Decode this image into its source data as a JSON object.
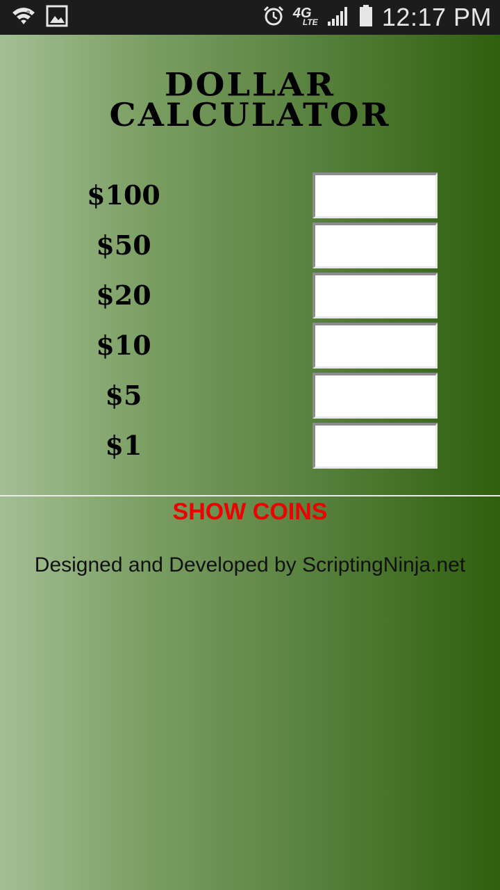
{
  "status_bar": {
    "time": "12:17 PM",
    "network_label": "4G",
    "network_sub": "LTE",
    "icons": [
      "wifi-icon",
      "image-notification-icon",
      "alarm-icon",
      "network-4g-lte-icon",
      "signal-icon",
      "battery-icon"
    ]
  },
  "app": {
    "title_line1": "DOLLAR",
    "title_line2": "CALCULATOR",
    "denominations": [
      {
        "label": "$100",
        "value": ""
      },
      {
        "label": "$50",
        "value": ""
      },
      {
        "label": "$20",
        "value": ""
      },
      {
        "label": "$10",
        "value": ""
      },
      {
        "label": "$5",
        "value": ""
      },
      {
        "label": "$1",
        "value": ""
      }
    ],
    "show_coins_label": "SHOW COINS",
    "footer_text": "Designed and Developed by ScriptingNinja.net"
  },
  "colors": {
    "gradient_left": "#a3bf94",
    "gradient_right": "#2f600d",
    "show_coins": "#ee0000",
    "status_bar_bg": "#1c1c1c"
  }
}
